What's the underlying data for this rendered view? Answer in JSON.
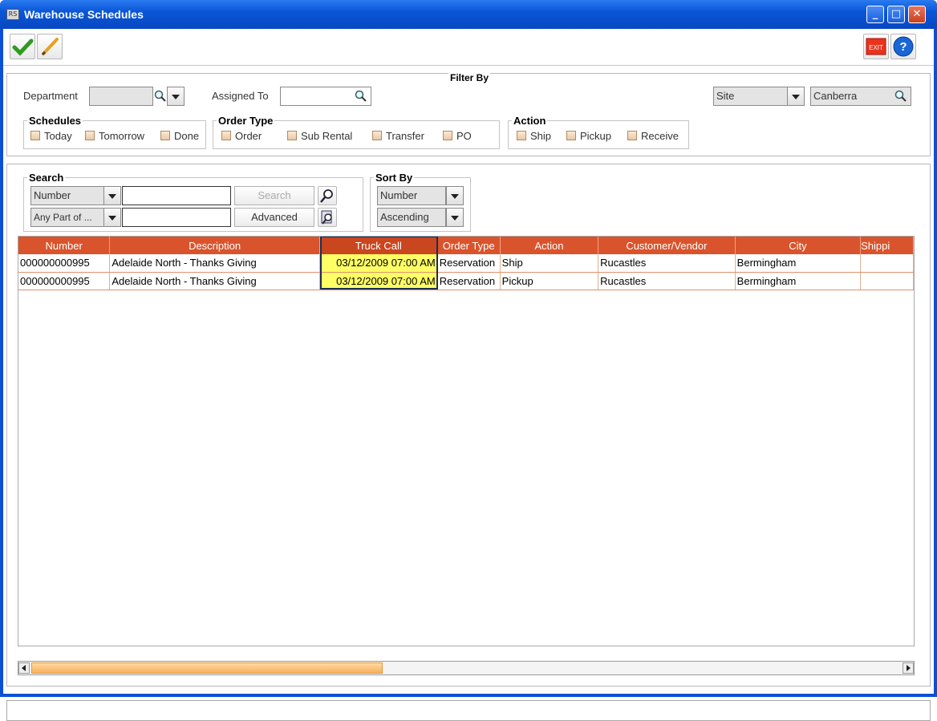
{
  "window": {
    "title": "Warehouse Schedules"
  },
  "filter": {
    "title": "Filter By",
    "department_label": "Department",
    "department_value": "",
    "assigned_label": "Assigned To",
    "assigned_value": "",
    "site_select": "Site",
    "site_value": "Canberra",
    "schedules": {
      "title": "Schedules",
      "items": [
        "Today",
        "Tomorrow",
        "Done"
      ]
    },
    "order_type": {
      "title": "Order Type",
      "items": [
        "Order",
        "Sub Rental",
        "Transfer",
        "PO"
      ]
    },
    "action": {
      "title": "Action",
      "items": [
        "Ship",
        "Pickup",
        "Receive"
      ]
    }
  },
  "search": {
    "title": "Search",
    "field_select": "Number",
    "match_select": "Any Part of ...",
    "value1": "",
    "value2": "",
    "search_button": "Search",
    "advanced_button": "Advanced"
  },
  "sort": {
    "title": "Sort By",
    "field": "Number",
    "order": "Ascending"
  },
  "table": {
    "columns": [
      "Number",
      "Description",
      "Truck Call",
      "Order Type",
      "Action",
      "Customer/Vendor",
      "City",
      "Shippi"
    ],
    "rows": [
      [
        "000000000995",
        "Adelaide North - Thanks Giving",
        "03/12/2009 07:00 AM",
        "Reservation",
        "Ship",
        "Rucastles",
        "Bermingham",
        ""
      ],
      [
        "000000000995",
        "Adelaide North - Thanks Giving",
        "03/12/2009 07:00 AM",
        "Reservation",
        "Pickup",
        "Rucastles",
        "Bermingham",
        ""
      ]
    ]
  },
  "icons": {
    "save": "check-icon",
    "edit": "pencil-icon",
    "exit": "exit-icon",
    "help": "help-icon",
    "lookup": "magnifier-icon",
    "find": "find-icon",
    "advanced": "advanced-search-icon"
  },
  "colors": {
    "header": "#d9542c",
    "selected_cell": "#ffff66",
    "title_bar": "#0a56d8"
  }
}
